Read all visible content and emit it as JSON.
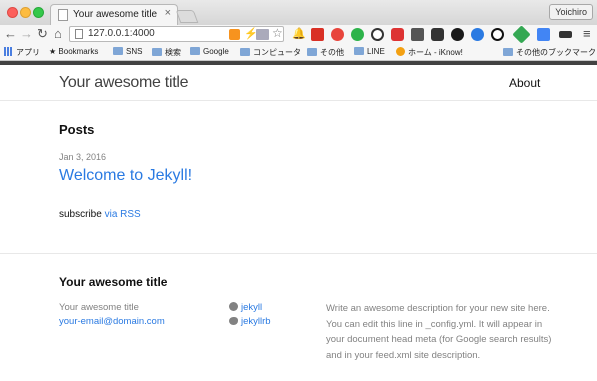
{
  "browser": {
    "tab_title": "Your awesome title",
    "tab_close": "×",
    "profile_name": "Yoichiro",
    "url": "127.0.0.1:4000",
    "bookmarks": [
      {
        "label": "アプリ",
        "icon": "apps-grid-icon"
      },
      {
        "label": "Bookmarks",
        "icon": "star-icon"
      },
      {
        "label": "SNS",
        "icon": "folder-icon"
      },
      {
        "label": "検索",
        "icon": "folder-icon"
      },
      {
        "label": "Google",
        "icon": "folder-icon"
      },
      {
        "label": "コンピュータ",
        "icon": "folder-icon"
      },
      {
        "label": "その他",
        "icon": "folder-icon"
      },
      {
        "label": "LINE",
        "icon": "folder-icon"
      },
      {
        "label": "ホーム - iKnow!",
        "icon": "iknow-icon"
      },
      {
        "label": "その他のブックマーク",
        "icon": "folder-icon"
      }
    ],
    "colors": {
      "link": "#2a7ae2",
      "chrome": "#f6f6f6"
    }
  },
  "page": {
    "site_title": "Your awesome title",
    "nav": {
      "about": "About"
    },
    "posts_heading": "Posts",
    "posts": [
      {
        "date": "Jan 3, 2016",
        "title": "Welcome to Jekyll!"
      }
    ],
    "subscribe_prefix": "subscribe",
    "subscribe_link": "via RSS"
  },
  "footer": {
    "heading": "Your awesome title",
    "name": "Your awesome title",
    "email": "your-email@domain.com",
    "github": "jekyll",
    "twitter": "jekyllrb",
    "description": "Write an awesome description for your new site here. You can edit this line in _config.yml. It will appear in your document head meta (for Google search results) and in your feed.xml site description."
  }
}
